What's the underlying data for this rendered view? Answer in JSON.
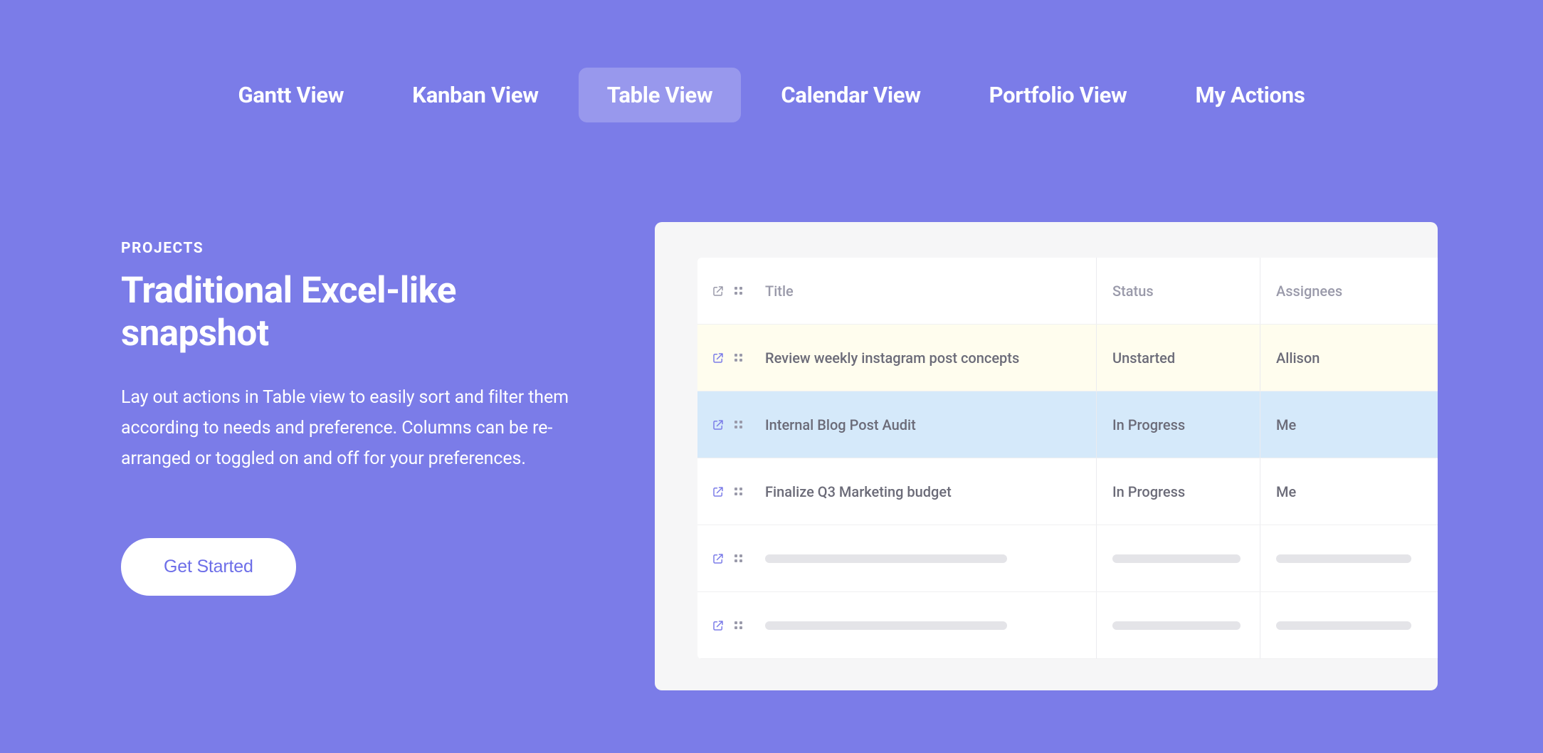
{
  "tabs": {
    "gantt": "Gantt View",
    "kanban": "Kanban View",
    "table": "Table View",
    "calendar": "Calendar View",
    "portfolio": "Portfolio View",
    "actions": "My Actions"
  },
  "hero": {
    "eyebrow": "PROJECTS",
    "heading": "Traditional Excel-like snapshot",
    "description": "Lay out actions in Table view to easily sort and filter them according to needs and preference. Columns can be re-arranged or toggled on and off for your preferences.",
    "cta": "Get Started"
  },
  "table": {
    "headers": {
      "title": "Title",
      "status": "Status",
      "assignees": "Assignees"
    },
    "rows": [
      {
        "title": "Review weekly instagram post concepts",
        "status": "Unstarted",
        "assignees": "Allison"
      },
      {
        "title": "Internal Blog Post Audit",
        "status": "In Progress",
        "assignees": "Me"
      },
      {
        "title": "Finalize Q3 Marketing budget",
        "status": "In Progress",
        "assignees": "Me"
      }
    ]
  }
}
